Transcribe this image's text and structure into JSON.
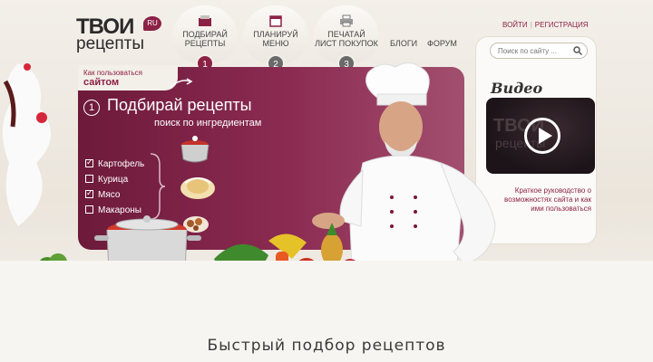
{
  "logo": {
    "line1": "ТВОИ",
    "line2": "рецепты",
    "badge": "RU"
  },
  "nav": {
    "steps": [
      {
        "label1": "подбирай",
        "label2": "рецепты",
        "num": "1",
        "icon": "recipe-icon"
      },
      {
        "label1": "планируй",
        "label2": "меню",
        "num": "2",
        "icon": "calendar-icon"
      },
      {
        "label1": "печатай",
        "label2": "лист покупок",
        "num": "3",
        "icon": "printer-icon"
      }
    ],
    "links": [
      "блоги",
      "форум"
    ]
  },
  "auth": {
    "login": "ВОЙТИ",
    "register": "РЕГИСТРАЦИЯ"
  },
  "search": {
    "placeholder": "Поиск по сайту ..."
  },
  "how": {
    "line1": "Как пользоваться",
    "line2": "сайтом"
  },
  "main": {
    "step": "1",
    "title": "Подбирай рецепты",
    "subtitle": "поиск по ингредиентам",
    "ingredients": [
      {
        "name": "Картофель",
        "checked": true
      },
      {
        "name": "Курица",
        "checked": false
      },
      {
        "name": "Мясо",
        "checked": true
      },
      {
        "name": "Макароны",
        "checked": false
      }
    ]
  },
  "video": {
    "title": "Видео",
    "desc": "Краткое руководство о возможностях сайта и как ими пользоваться",
    "watermark1": "ТВОИ",
    "watermark2": "рецепты"
  },
  "bottom": {
    "title": "Быстрый подбор рецептов"
  },
  "colors": {
    "accent": "#8c2146",
    "panel": "#7a2045"
  }
}
